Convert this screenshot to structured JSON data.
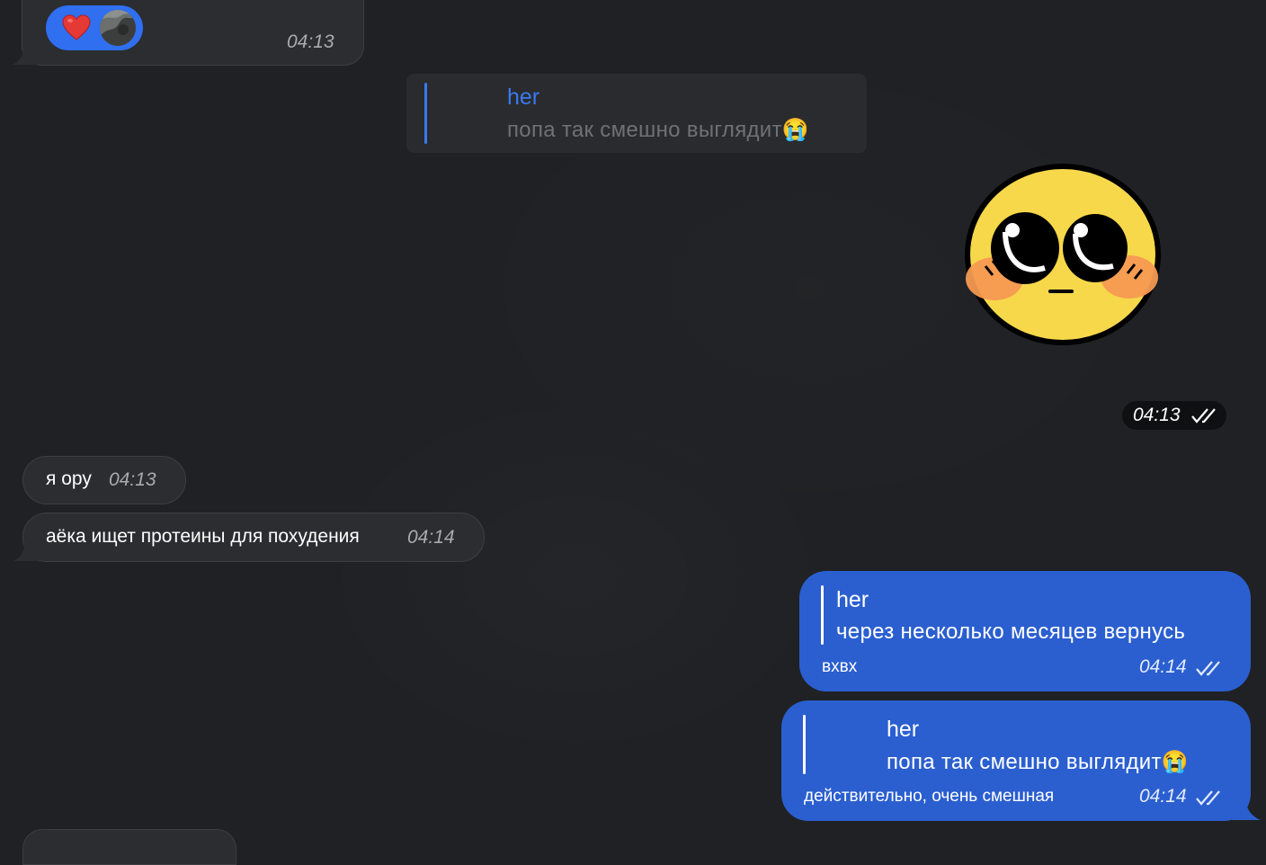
{
  "messages": {
    "reaction_msg": {
      "time": "04:13",
      "reaction": "heart-emoji"
    },
    "quoted_reply": {
      "author": "her",
      "text": "попа так смешно выглядит",
      "emoji": "😭"
    },
    "sticker_msg": {
      "time": "04:13",
      "sticker": "blushing-face-sticker"
    },
    "msg1": {
      "text": "я ору",
      "time": "04:13"
    },
    "msg2": {
      "text": "аёка ищет протеины для похудения",
      "time": "04:14"
    },
    "out1": {
      "reply_author": "her",
      "reply_text": "через несколько месяцев вернусь",
      "text": "вхвх",
      "time": "04:14"
    },
    "out2": {
      "reply_author": "her",
      "reply_text": "попа так смешно выглядит",
      "reply_emoji": "😭",
      "text": "действительно, очень смешная",
      "time": "04:14"
    }
  },
  "colors": {
    "background": "#1f2124",
    "incoming_bubble": "#2c2d30",
    "outgoing_bubble": "#2b5fd0",
    "accent_blue": "#3a7af0",
    "reaction_pill": "#2f6ff0"
  }
}
